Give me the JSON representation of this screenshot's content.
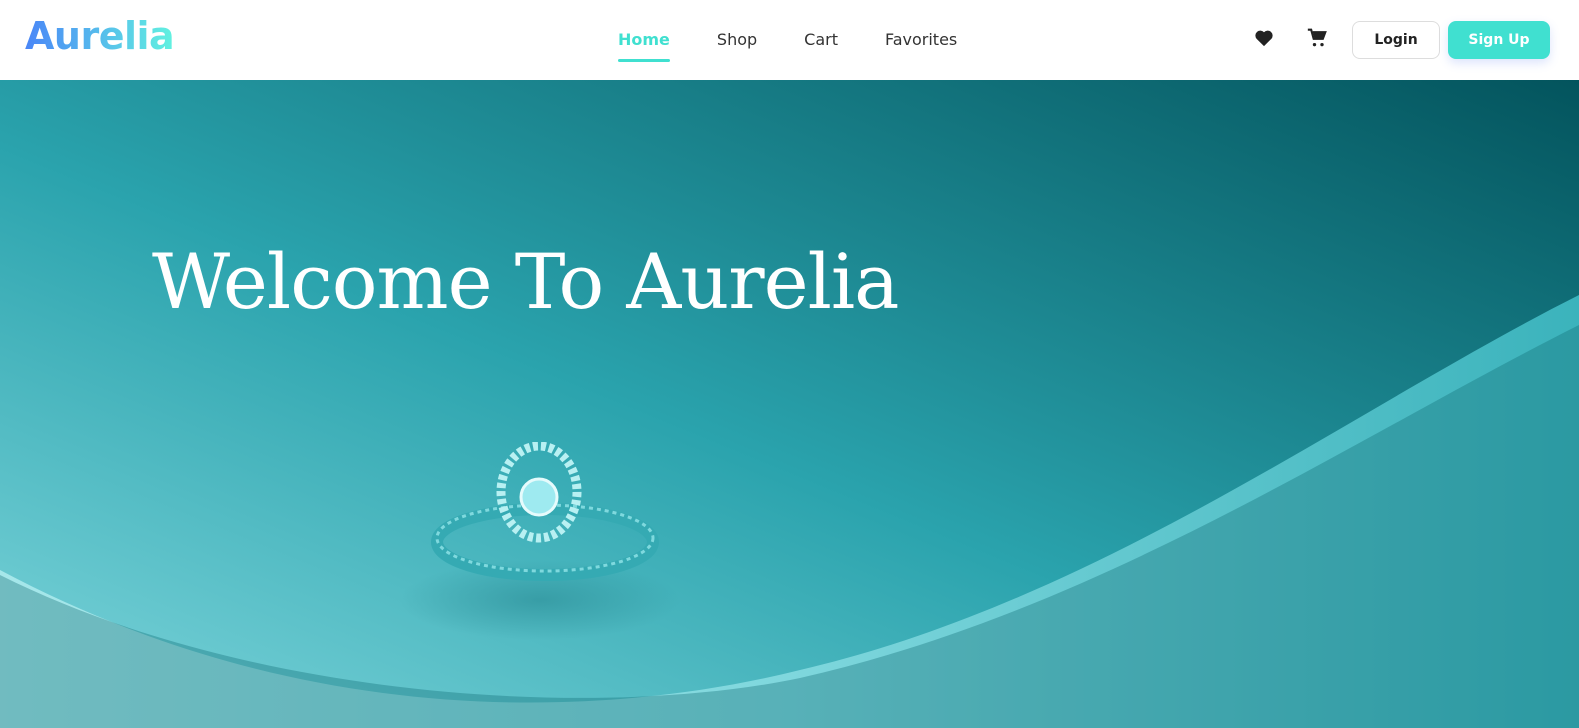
{
  "brand": {
    "name": "Aurelia"
  },
  "nav": {
    "links": [
      {
        "label": "Home",
        "active": true
      },
      {
        "label": "Shop"
      },
      {
        "label": "Cart"
      },
      {
        "label": "Favorites"
      }
    ],
    "icons": [
      "heart-icon",
      "cart-icon"
    ],
    "login_label": "Login",
    "signup_label": "Sign Up"
  },
  "hero": {
    "title": "Welcome To Aurelia"
  },
  "colors": {
    "accent": "#40e0d0",
    "hero_dark": "#05707a",
    "hero_light": "#8fdde3"
  }
}
